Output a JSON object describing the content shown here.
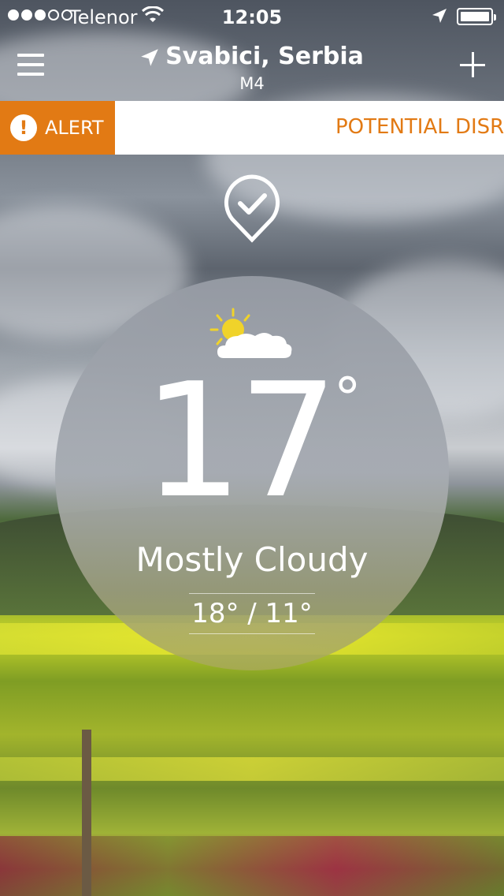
{
  "status_bar": {
    "carrier": "Telenor",
    "time": "12:05"
  },
  "header": {
    "location": "Svabici, Serbia",
    "sublocation": "M4"
  },
  "alert": {
    "label": "ALERT",
    "icon_text": "!",
    "message": "POTENTIAL DISR"
  },
  "weather": {
    "temperature": "17",
    "degree_symbol": "°",
    "condition": "Mostly Cloudy",
    "high_low": "18° / 11°",
    "icon": "partly-sunny-icon"
  },
  "colors": {
    "alert_orange": "#e27a14",
    "white": "#ffffff"
  }
}
